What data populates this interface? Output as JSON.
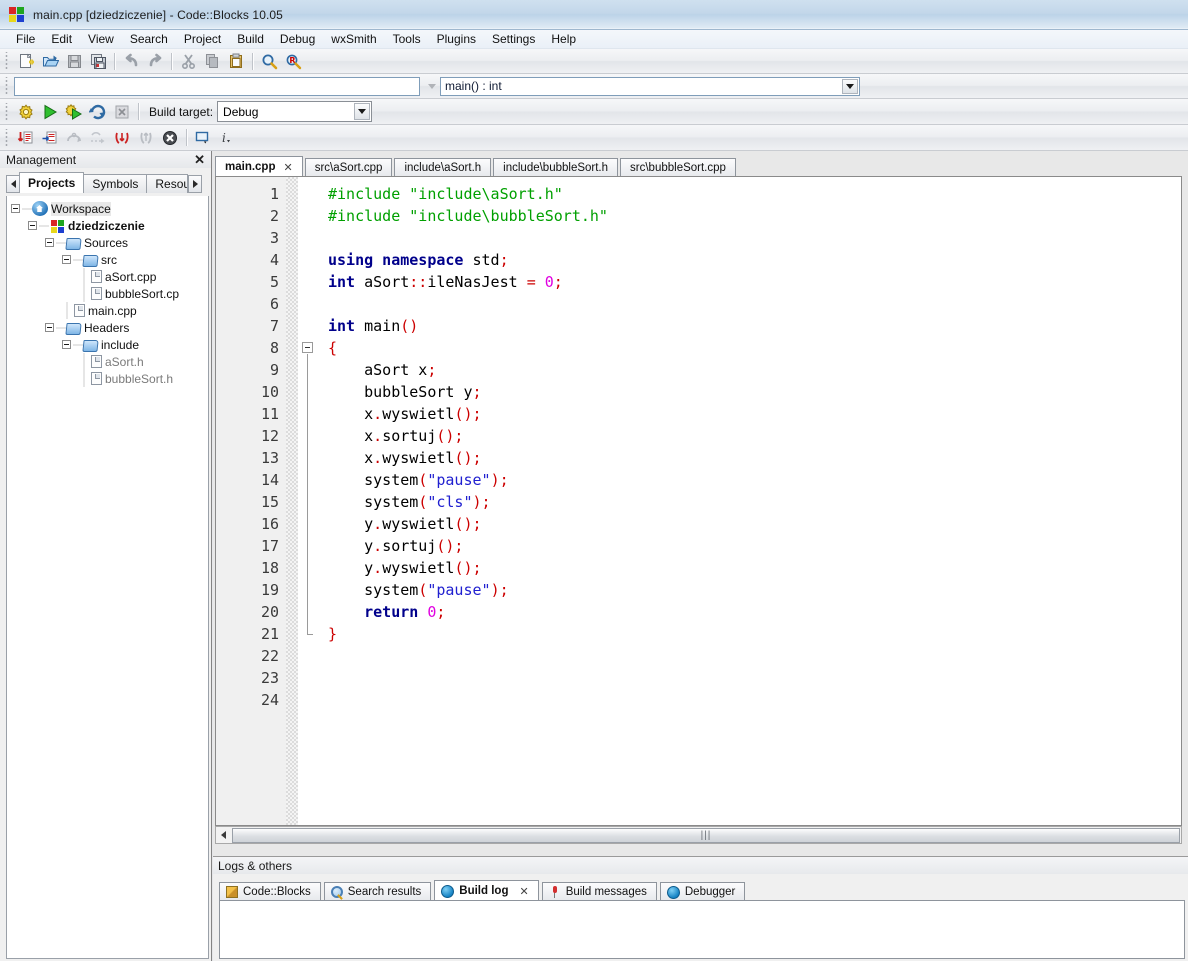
{
  "window": {
    "title": "main.cpp [dziedziczenie] - Code::Blocks 10.05",
    "app_icon": "codeblocks-logo-icon"
  },
  "menubar": {
    "items": [
      {
        "label": "File"
      },
      {
        "label": "Edit"
      },
      {
        "label": "View"
      },
      {
        "label": "Search"
      },
      {
        "label": "Project"
      },
      {
        "label": "Build"
      },
      {
        "label": "Debug"
      },
      {
        "label": "wxSmith"
      },
      {
        "label": "Tools"
      },
      {
        "label": "Plugins"
      },
      {
        "label": "Settings"
      },
      {
        "label": "Help"
      }
    ]
  },
  "toolbars": {
    "main": [
      {
        "name": "new-file-icon",
        "title": "New file"
      },
      {
        "name": "open-file-icon",
        "title": "Open"
      },
      {
        "name": "save-icon",
        "title": "Save",
        "disabled": true
      },
      {
        "name": "save-all-icon",
        "title": "Save all"
      },
      {
        "name": "undo-icon",
        "title": "Undo",
        "disabled": true
      },
      {
        "name": "redo-icon",
        "title": "Redo",
        "disabled": true
      },
      {
        "name": "cut-icon",
        "title": "Cut",
        "disabled": true
      },
      {
        "name": "copy-icon",
        "title": "Copy",
        "disabled": true
      },
      {
        "name": "paste-icon",
        "title": "Paste"
      },
      {
        "name": "find-icon",
        "title": "Find"
      },
      {
        "name": "replace-icon",
        "title": "Replace"
      }
    ],
    "search_bar": {
      "goto_value": "",
      "scope_value": "main() : int"
    },
    "build": {
      "target_label": "Build target:",
      "target_value": "Debug",
      "buttons": [
        {
          "name": "build-icon",
          "title": "Build"
        },
        {
          "name": "run-icon",
          "title": "Run"
        },
        {
          "name": "build-and-run-icon",
          "title": "Build and run"
        },
        {
          "name": "rebuild-icon",
          "title": "Rebuild"
        },
        {
          "name": "abort-icon",
          "title": "Abort",
          "disabled": true
        }
      ]
    },
    "debug": [
      {
        "name": "debug-continue-icon",
        "title": "Debug / Continue"
      },
      {
        "name": "run-to-cursor-icon",
        "title": "Run to cursor"
      },
      {
        "name": "next-line-icon",
        "title": "Next line"
      },
      {
        "name": "next-instruction-icon",
        "title": "Next instruction"
      },
      {
        "name": "step-into-icon",
        "title": "Step into"
      },
      {
        "name": "step-out-icon",
        "title": "Step out"
      },
      {
        "name": "stop-debugger-icon",
        "title": "Stop debugger"
      },
      {
        "name": "debug-windows-icon",
        "title": "Debugging windows"
      },
      {
        "name": "various-info-icon",
        "title": "Various info"
      }
    ]
  },
  "management": {
    "title": "Management",
    "close_label": "✕",
    "tabs": [
      {
        "label": "Projects",
        "active": true
      },
      {
        "label": "Symbols",
        "active": false
      },
      {
        "label": "Resou",
        "active": false
      }
    ],
    "tree": [
      {
        "label": "Workspace",
        "depth": 0,
        "icon": "home-icon",
        "style": "selected"
      },
      {
        "label": "dziedziczenie",
        "depth": 1,
        "icon": "project-icon",
        "style": "bold"
      },
      {
        "label": "Sources",
        "depth": 2,
        "icon": "folder-icon",
        "style": "normal"
      },
      {
        "label": "src",
        "depth": 3,
        "icon": "folder-icon",
        "style": "normal"
      },
      {
        "label": "aSort.cpp",
        "depth": 4,
        "icon": "file-icon",
        "style": "normal"
      },
      {
        "label": "bubbleSort.cp",
        "depth": 4,
        "icon": "file-icon",
        "style": "normal"
      },
      {
        "label": "main.cpp",
        "depth": 3,
        "icon": "file-icon",
        "style": "normal"
      },
      {
        "label": "Headers",
        "depth": 2,
        "icon": "folder-icon",
        "style": "normal"
      },
      {
        "label": "include",
        "depth": 3,
        "icon": "folder-icon",
        "style": "normal"
      },
      {
        "label": "aSort.h",
        "depth": 4,
        "icon": "file-icon",
        "style": "gray"
      },
      {
        "label": "bubbleSort.h",
        "depth": 4,
        "icon": "file-icon",
        "style": "gray"
      }
    ]
  },
  "editor": {
    "tabs": [
      {
        "label": "main.cpp",
        "active": true,
        "close": "✕"
      },
      {
        "label": "src\\aSort.cpp",
        "active": false
      },
      {
        "label": "include\\aSort.h",
        "active": false
      },
      {
        "label": "include\\bubbleSort.h",
        "active": false
      },
      {
        "label": "src\\bubbleSort.cpp",
        "active": false
      }
    ],
    "line_numbers": [
      1,
      2,
      3,
      4,
      5,
      6,
      7,
      8,
      9,
      10,
      11,
      12,
      13,
      14,
      15,
      16,
      17,
      18,
      19,
      20,
      21,
      22,
      23,
      24
    ],
    "code_lines": [
      {
        "n": 1,
        "tokens": [
          {
            "t": "#include ",
            "c": "c"
          },
          {
            "t": "\"include\\aSort.h\"",
            "c": "c"
          }
        ]
      },
      {
        "n": 2,
        "tokens": [
          {
            "t": "#include ",
            "c": "c"
          },
          {
            "t": "\"include\\bubbleSort.h\"",
            "c": "c"
          }
        ]
      },
      {
        "n": 3,
        "tokens": []
      },
      {
        "n": 4,
        "tokens": [
          {
            "t": "using namespace",
            "c": "k"
          },
          {
            "t": " std",
            "c": "id"
          },
          {
            "t": ";",
            "c": "p"
          }
        ]
      },
      {
        "n": 5,
        "tokens": [
          {
            "t": "int",
            "c": "k"
          },
          {
            "t": " aSort",
            "c": "id"
          },
          {
            "t": "::",
            "c": "p"
          },
          {
            "t": "ileNasJest ",
            "c": "id"
          },
          {
            "t": "=",
            "c": "p"
          },
          {
            "t": " ",
            "c": "id"
          },
          {
            "t": "0",
            "c": "n"
          },
          {
            "t": ";",
            "c": "p"
          }
        ]
      },
      {
        "n": 6,
        "tokens": []
      },
      {
        "n": 7,
        "tokens": [
          {
            "t": "int",
            "c": "k"
          },
          {
            "t": " main",
            "c": "id"
          },
          {
            "t": "()",
            "c": "p"
          }
        ]
      },
      {
        "n": 8,
        "tokens": [
          {
            "t": "{",
            "c": "p"
          }
        ]
      },
      {
        "n": 9,
        "tokens": [
          {
            "t": "    aSort x",
            "c": "id"
          },
          {
            "t": ";",
            "c": "p"
          }
        ]
      },
      {
        "n": 10,
        "tokens": [
          {
            "t": "    bubbleSort y",
            "c": "id"
          },
          {
            "t": ";",
            "c": "p"
          }
        ]
      },
      {
        "n": 11,
        "tokens": [
          {
            "t": "    x",
            "c": "id"
          },
          {
            "t": ".",
            "c": "p"
          },
          {
            "t": "wyswietl",
            "c": "id"
          },
          {
            "t": "();",
            "c": "p"
          }
        ]
      },
      {
        "n": 12,
        "tokens": [
          {
            "t": "    x",
            "c": "id"
          },
          {
            "t": ".",
            "c": "p"
          },
          {
            "t": "sortuj",
            "c": "id"
          },
          {
            "t": "();",
            "c": "p"
          }
        ]
      },
      {
        "n": 13,
        "tokens": [
          {
            "t": "    x",
            "c": "id"
          },
          {
            "t": ".",
            "c": "p"
          },
          {
            "t": "wyswietl",
            "c": "id"
          },
          {
            "t": "();",
            "c": "p"
          }
        ]
      },
      {
        "n": 14,
        "tokens": [
          {
            "t": "    system",
            "c": "id"
          },
          {
            "t": "(",
            "c": "p"
          },
          {
            "t": "\"pause\"",
            "c": "s"
          },
          {
            "t": ");",
            "c": "p"
          }
        ]
      },
      {
        "n": 15,
        "tokens": [
          {
            "t": "    system",
            "c": "id"
          },
          {
            "t": "(",
            "c": "p"
          },
          {
            "t": "\"cls\"",
            "c": "s"
          },
          {
            "t": ");",
            "c": "p"
          }
        ]
      },
      {
        "n": 16,
        "tokens": [
          {
            "t": "    y",
            "c": "id"
          },
          {
            "t": ".",
            "c": "p"
          },
          {
            "t": "wyswietl",
            "c": "id"
          },
          {
            "t": "();",
            "c": "p"
          }
        ]
      },
      {
        "n": 17,
        "tokens": [
          {
            "t": "    y",
            "c": "id"
          },
          {
            "t": ".",
            "c": "p"
          },
          {
            "t": "sortuj",
            "c": "id"
          },
          {
            "t": "();",
            "c": "p"
          }
        ]
      },
      {
        "n": 18,
        "tokens": [
          {
            "t": "    y",
            "c": "id"
          },
          {
            "t": ".",
            "c": "p"
          },
          {
            "t": "wyswietl",
            "c": "id"
          },
          {
            "t": "();",
            "c": "p"
          }
        ]
      },
      {
        "n": 19,
        "tokens": [
          {
            "t": "    system",
            "c": "id"
          },
          {
            "t": "(",
            "c": "p"
          },
          {
            "t": "\"pause\"",
            "c": "s"
          },
          {
            "t": ");",
            "c": "p"
          }
        ]
      },
      {
        "n": 20,
        "tokens": [
          {
            "t": "    ",
            "c": "id"
          },
          {
            "t": "return",
            "c": "k"
          },
          {
            "t": " ",
            "c": "id"
          },
          {
            "t": "0",
            "c": "n"
          },
          {
            "t": ";",
            "c": "p"
          }
        ]
      },
      {
        "n": 21,
        "tokens": [
          {
            "t": "}",
            "c": "p"
          }
        ]
      },
      {
        "n": 22,
        "tokens": []
      },
      {
        "n": 23,
        "tokens": []
      },
      {
        "n": 24,
        "tokens": []
      }
    ],
    "fold_marker_line": 8,
    "scrollbar_grip": "|||"
  },
  "logs": {
    "title": "Logs & others",
    "tabs": [
      {
        "label": "Code::Blocks",
        "icon": "pencil-icon",
        "active": false
      },
      {
        "label": "Search results",
        "icon": "magnifier-icon",
        "active": false
      },
      {
        "label": "Build log",
        "icon": "gear-icon",
        "active": true,
        "close": "✕"
      },
      {
        "label": "Build messages",
        "icon": "pin-icon",
        "active": false
      },
      {
        "label": "Debugger",
        "icon": "gear-icon",
        "active": false
      }
    ],
    "content": ""
  },
  "colors": {
    "keyword": "#00008b",
    "punctuation": "#cc0000",
    "string": "#2020d0",
    "number": "#e000e0",
    "preprocessor": "#00a000",
    "titlebar": "#bcd3e8"
  }
}
